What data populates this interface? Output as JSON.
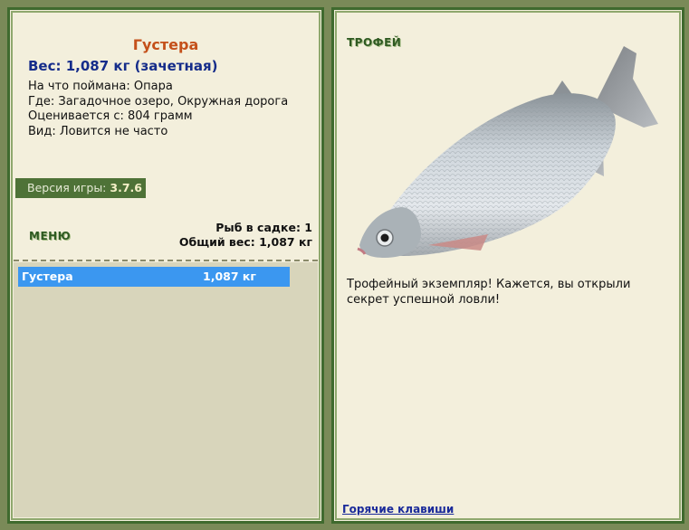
{
  "fish": {
    "name": "Густера",
    "weight_line": "Вес: 1,087 кг (зачетная)",
    "bait": "На что поймана: Опара",
    "location": "Где: Загадочное озеро, Окружная дорога",
    "rated": "Оценивается с: 804 грамм",
    "kind": "Вид: Ловится не часто"
  },
  "version": {
    "label": "Версия игры:",
    "value": "3.7.6"
  },
  "menu": {
    "label": "МЕНЮ"
  },
  "cage": {
    "count": "Рыб в садке: 1",
    "total": "Общий вес: 1,087 кг"
  },
  "catch_list": [
    {
      "name": "Густера",
      "weight": "1,087 кг"
    }
  ],
  "trophy": {
    "title": "ТРОФЕЙ",
    "image": "bream-fish-image",
    "text": "Трофейный экземпляр! Кажется, вы открыли секрет успешной ловли!"
  },
  "hotkeys": {
    "label": "Горячие клавиши"
  },
  "colors": {
    "panel_bg": "#f3efdc",
    "frame": "#3f6a2e",
    "fish_title": "#c4501a",
    "weight": "#152c8a",
    "selected_row": "#3b97f0"
  }
}
